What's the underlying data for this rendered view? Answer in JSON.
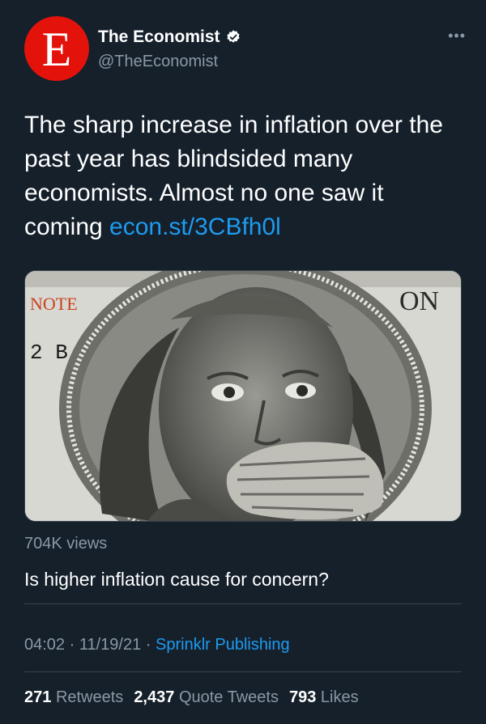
{
  "account": {
    "avatar_letter": "E",
    "name": "The Economist",
    "handle": "@TheEconomist",
    "verified_icon": "verified-badge-icon",
    "more_icon": "more-options-icon"
  },
  "tweet": {
    "text": "The sharp increase in inflation over the past year has blindsided many economists. Almost no one saw it coming ",
    "link": "econ.st/3CBfh0l"
  },
  "media": {
    "alt": "Benjamin Franklin on a $100 bill covering his mouth with his hand",
    "bill_text_left": "NOTE",
    "bill_serial": "2 B",
    "bill_corner": "ON",
    "brand": "The Economist"
  },
  "video": {
    "views": "704K views",
    "title": "Is higher inflation cause for concern?"
  },
  "meta": {
    "time": "04:02",
    "separator": "·",
    "date": "11/19/21",
    "source": "Sprinklr Publishing"
  },
  "stats": {
    "retweets_count": "271",
    "retweets_label": "Retweets",
    "quotes_count": "2,437",
    "quotes_label": "Quote Tweets",
    "likes_count": "793",
    "likes_label": "Likes"
  },
  "colors": {
    "background": "#15202b",
    "link": "#1d9bf0",
    "secondary_text": "#8b98a5",
    "brand_red": "#e3120b"
  }
}
